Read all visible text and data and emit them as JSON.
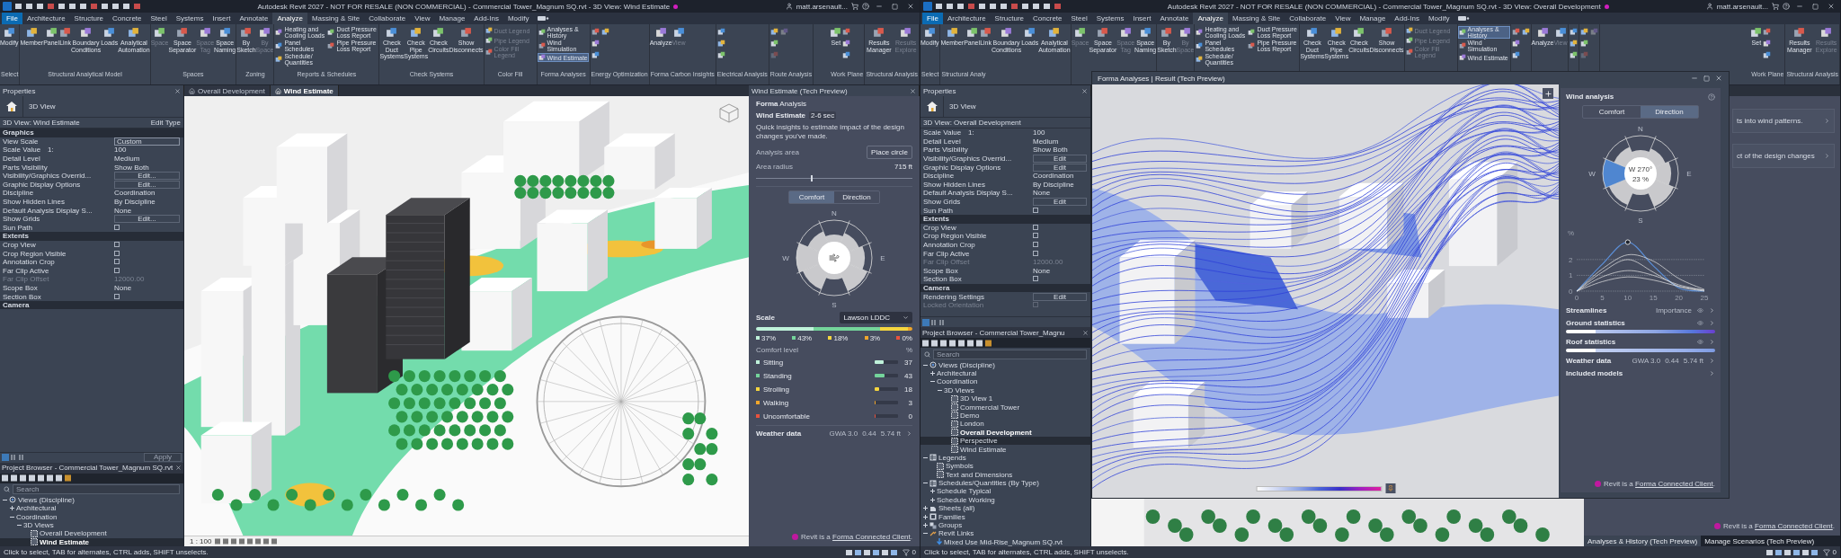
{
  "windows": [
    {
      "title": "Autodesk Revit 2027 - NOT FOR RESALE (NON COMMERCIAL) - Commercial Tower_Magnum SQ.rvt - 3D View: Wind Estimate",
      "user": "matt.arsenault...",
      "menu_tabs": [
        {
          "label": "File",
          "kind": "file",
          "selected": false
        },
        {
          "label": "Architecture",
          "kind": "tab",
          "selected": false
        },
        {
          "label": "Structure",
          "kind": "tab",
          "selected": false
        },
        {
          "label": "Concrete",
          "kind": "tab",
          "selected": false
        },
        {
          "label": "Steel",
          "kind": "tab",
          "selected": false
        },
        {
          "label": "Systems",
          "kind": "tab",
          "selected": false
        },
        {
          "label": "Insert",
          "kind": "tab",
          "selected": false
        },
        {
          "label": "Annotate",
          "kind": "tab",
          "selected": false
        },
        {
          "label": "Analyze",
          "kind": "tab",
          "selected": true
        },
        {
          "label": "Massing & Site",
          "kind": "tab",
          "selected": false
        },
        {
          "label": "Collaborate",
          "kind": "tab",
          "selected": false
        },
        {
          "label": "View",
          "kind": "tab",
          "selected": false
        },
        {
          "label": "Manage",
          "kind": "tab",
          "selected": false
        },
        {
          "label": "Add-Ins",
          "kind": "tab",
          "selected": false
        },
        {
          "label": "Modify",
          "kind": "tab",
          "selected": false
        }
      ],
      "ribbon": [
        {
          "label": "Select",
          "items": [
            {
              "kind": "large",
              "label": "Modify",
              "disabled": false
            }
          ]
        },
        {
          "label": "Structural Analytical Model",
          "items": [
            {
              "kind": "large",
              "label": "Member",
              "disabled": false
            },
            {
              "kind": "large",
              "label": "Panel",
              "disabled": false
            },
            {
              "kind": "large",
              "label": "Link",
              "disabled": false
            },
            {
              "kind": "large",
              "label": "Boundary Conditions",
              "disabled": false
            },
            {
              "kind": "large",
              "label": "Loads",
              "disabled": false
            },
            {
              "kind": "large",
              "label": "Analytical Automation",
              "disabled": false
            }
          ]
        },
        {
          "label": "Spaces",
          "items": [
            {
              "kind": "large",
              "label": "Space",
              "disabled": true
            },
            {
              "kind": "large",
              "label": "Space Separator",
              "disabled": false
            },
            {
              "kind": "large",
              "label": "Space Tag",
              "disabled": true
            },
            {
              "kind": "large",
              "label": "Space Naming",
              "disabled": false
            }
          ]
        },
        {
          "label": "Zoning",
          "items": [
            {
              "kind": "large",
              "label": "By Sketch",
              "disabled": false
            },
            {
              "kind": "large",
              "label": "By Space",
              "disabled": true
            }
          ]
        },
        {
          "label": "Reports & Schedules",
          "items": [
            {
              "kind": "small",
              "label": "Heating and Cooling Loads",
              "disabled": false
            },
            {
              "kind": "small",
              "label": "Panel Schedules",
              "disabled": false
            },
            {
              "kind": "small",
              "label": "Schedule/ Quantities",
              "disabled": false
            },
            {
              "kind": "small",
              "label": "Duct Pressure Loss Report",
              "disabled": false
            },
            {
              "kind": "small",
              "label": "Pipe Pressure Loss Report",
              "disabled": false
            }
          ]
        },
        {
          "label": "Check Systems",
          "items": [
            {
              "kind": "large",
              "label": "Check Duct Systems",
              "disabled": false
            },
            {
              "kind": "large",
              "label": "Check Pipe Systems",
              "disabled": false
            },
            {
              "kind": "large",
              "label": "Check Circuits",
              "disabled": false
            },
            {
              "kind": "large",
              "label": "Show Disconnects",
              "disabled": false
            }
          ]
        },
        {
          "label": "Color Fill",
          "items": [
            {
              "kind": "small",
              "label": "Duct Legend",
              "disabled": true
            },
            {
              "kind": "small",
              "label": "Pipe Legend",
              "disabled": true
            },
            {
              "kind": "small",
              "label": "Color Fill Legend",
              "disabled": true
            }
          ]
        },
        {
          "label": "Forma Analyses",
          "items": [
            {
              "kind": "small",
              "label": "Analyses & History",
              "disabled": false,
              "selected": false
            },
            {
              "kind": "small",
              "label": "Wind Simulation",
              "disabled": false,
              "selected": false
            },
            {
              "kind": "small",
              "label": "Wind Estimate",
              "disabled": false,
              "selected": true
            }
          ]
        },
        {
          "label": "Energy Optimization",
          "items": [
            {
              "kind": "icon",
              "disabled": false
            },
            {
              "kind": "icon",
              "disabled": false
            },
            {
              "kind": "icon",
              "disabled": false
            },
            {
              "kind": "icon",
              "disabled": false
            }
          ]
        },
        {
          "label": "Forma Carbon Insights",
          "items": [
            {
              "kind": "large",
              "label": "Analyze",
              "disabled": false
            },
            {
              "kind": "large",
              "label": "View",
              "disabled": true
            }
          ]
        },
        {
          "label": "Electrical Analysis",
          "items": [
            {
              "kind": "icon",
              "disabled": false
            },
            {
              "kind": "icon",
              "disabled": false
            },
            {
              "kind": "icon",
              "disabled": false
            }
          ]
        },
        {
          "label": "Route Analysis",
          "items": [
            {
              "kind": "icon",
              "disabled": false
            },
            {
              "kind": "icon",
              "disabled": false
            },
            {
              "kind": "icon",
              "disabled": true
            },
            {
              "kind": "icon",
              "disabled": true
            }
          ]
        },
        {
          "label": "Work Plane",
          "items": [
            {
              "kind": "large",
              "label": "Set",
              "disabled": false
            },
            {
              "kind": "icon",
              "disabled": false
            },
            {
              "kind": "icon",
              "disabled": false
            },
            {
              "kind": "icon",
              "disabled": false
            }
          ]
        },
        {
          "label": "Structural Analysis",
          "items": [
            {
              "kind": "large",
              "label": "Results Manager",
              "disabled": false
            },
            {
              "kind": "large",
              "label": "Results Explore",
              "disabled": true
            }
          ]
        }
      ],
      "dock_header": "Properties",
      "view_tabs": [
        {
          "label": "Overall Development",
          "selected": false
        },
        {
          "label": "Wind Estimate",
          "selected": true
        }
      ],
      "side_header": "Wind Estimate (Tech Preview)",
      "properties": {
        "type": "3D View",
        "instance": "3D View: Wind Estimate",
        "edit_type": "Edit Type",
        "apply": "Apply",
        "sections": [
          {
            "title": "Graphics",
            "rows": [
              {
                "label": "View Scale",
                "kind": "field",
                "value": "Custom",
                "disabled": false
              },
              {
                "label": "Scale Value",
                "unit": "1:",
                "kind": "text",
                "value": "100",
                "disabled": false
              },
              {
                "label": "Detail Level",
                "kind": "text",
                "value": "Medium",
                "disabled": false
              },
              {
                "label": "Parts Visibility",
                "kind": "text",
                "value": "Show Both",
                "disabled": false
              },
              {
                "label": "Visibility/Graphics Overrid...",
                "kind": "button",
                "value": "Edit...",
                "disabled": false
              },
              {
                "label": "Graphic Display Options",
                "kind": "button",
                "value": "Edit...",
                "disabled": false
              },
              {
                "label": "Discipline",
                "kind": "text",
                "value": "Coordination",
                "disabled": false
              },
              {
                "label": "Show Hidden Lines",
                "kind": "text",
                "value": "By Discipline",
                "disabled": false
              },
              {
                "label": "Default Analysis Display S...",
                "kind": "text",
                "value": "None",
                "disabled": false
              },
              {
                "label": "Show Grids",
                "kind": "button",
                "value": "Edit...",
                "disabled": false
              },
              {
                "label": "Sun Path",
                "kind": "checkbox",
                "checked": false,
                "disabled": false
              }
            ]
          },
          {
            "title": "Extents",
            "rows": [
              {
                "label": "Crop View",
                "kind": "checkbox",
                "checked": false,
                "disabled": false
              },
              {
                "label": "Crop Region Visible",
                "kind": "checkbox",
                "checked": false,
                "disabled": false
              },
              {
                "label": "Annotation Crop",
                "kind": "checkbox",
                "checked": false,
                "disabled": false
              },
              {
                "label": "Far Clip Active",
                "kind": "checkbox",
                "checked": false,
                "disabled": false
              },
              {
                "label": "Far Clip Offset",
                "kind": "text",
                "value": "12000.00",
                "disabled": true
              },
              {
                "label": "Scope Box",
                "kind": "text",
                "value": "None",
                "disabled": false
              },
              {
                "label": "Section Box",
                "kind": "checkbox",
                "checked": false,
                "disabled": false
              }
            ]
          },
          {
            "title": "Camera"
          }
        ]
      },
      "browser": {
        "title": "Project Browser - Commercial Tower_Magnum SQ.rvt",
        "search_placeholder": "Search",
        "tree": [
          {
            "label": "Views (Discipline)",
            "kind": "views",
            "expanded": true,
            "children": [
              {
                "label": "Architectural",
                "expanded": false
              },
              {
                "label": "Coordination",
                "expanded": true,
                "children": [
                  {
                    "label": "3D Views",
                    "expanded": true,
                    "children": [
                      {
                        "label": "Overall Development",
                        "kind": "view",
                        "current": false,
                        "selected": false
                      },
                      {
                        "label": "Wind Estimate",
                        "kind": "view",
                        "current": true,
                        "selected": true
                      }
                    ]
                  }
                ]
              }
            ]
          }
        ]
      },
      "viewport": {
        "kind": "city",
        "scale": "1 : 100"
      },
      "side_panel": {
        "kind": "wind_estimate",
        "brand": "**Forma** Analysis",
        "heading": "Wind Estimate",
        "badge": "2-6 sec",
        "description": "Quick insights to estimate impact of the design changes you've made.",
        "area_label": "Analysis area",
        "area_button": "Place circle",
        "radius_label": "Area radius",
        "radius_value": "715 ft",
        "radius_slider": {
          "level": 0.35
        },
        "tabs": [
          {
            "label": "Comfort",
            "selected": true
          },
          {
            "label": "Direction",
            "selected": false
          }
        ],
        "rose": {
          "kind": "comfort",
          "labels": [
            "N",
            "E",
            "S",
            "W"
          ]
        },
        "scale_label": "Scale",
        "scale_value": "Lawson LDDC",
        "shares": [
          {
            "text": "37%",
            "color": "#bff2da"
          },
          {
            "text": "43%",
            "color": "#74d49b"
          },
          {
            "text": "18%",
            "color": "#f5d53f"
          },
          {
            "text": "3%",
            "color": "#f0a62c"
          },
          {
            "text": "0%",
            "color": "#e8523d"
          }
        ],
        "comfort_header": "Comfort level",
        "percent_header": "%",
        "comfort_rows": [
          {
            "label": "Sitting",
            "value": "37",
            "level": 0.37,
            "color": "#bff2da"
          },
          {
            "label": "Standing",
            "value": "43",
            "level": 0.43,
            "color": "#74d49b"
          },
          {
            "label": "Strolling",
            "value": "18",
            "level": 0.18,
            "color": "#f5d53f"
          },
          {
            "label": "Walking",
            "value": "3",
            "level": 0.03,
            "color": "#f0a62c"
          },
          {
            "label": "Uncomfortable",
            "value": "0",
            "level": 0,
            "color": "#e8523d"
          }
        ],
        "weather": {
          "label": "Weather data",
          "values": [
            "GWA 3.0",
            "0.44",
            "5.74 ft"
          ]
        },
        "footer": {
          "text": "Revit is a ",
          "link": "Forma Connected Client",
          "after": "."
        }
      },
      "status": "Click to select, TAB for alternates, CTRL adds, SHIFT unselects.",
      "filter_count": "0"
    },
    {
      "title": "Autodesk Revit 2027 - NOT FOR RESALE (NON COMMERCIAL) - Commercial Tower_Magnum SQ.rvt - 3D View: Overall Development",
      "user": "matt.arsenault...",
      "menu_tabs": [
        {
          "label": "File",
          "kind": "file",
          "selected": false
        },
        {
          "label": "Architecture",
          "kind": "tab",
          "selected": false
        },
        {
          "label": "Structure",
          "kind": "tab",
          "selected": false
        },
        {
          "label": "Concrete",
          "kind": "tab",
          "selected": false
        },
        {
          "label": "Steel",
          "kind": "tab",
          "selected": false
        },
        {
          "label": "Systems",
          "kind": "tab",
          "selected": false
        },
        {
          "label": "Insert",
          "kind": "tab",
          "selected": false
        },
        {
          "label": "Annotate",
          "kind": "tab",
          "selected": false
        },
        {
          "label": "Analyze",
          "kind": "tab",
          "selected": true
        },
        {
          "label": "Massing & Site",
          "kind": "tab",
          "selected": false
        },
        {
          "label": "Collaborate",
          "kind": "tab",
          "selected": false
        },
        {
          "label": "View",
          "kind": "tab",
          "selected": false
        },
        {
          "label": "Manage",
          "kind": "tab",
          "selected": false
        },
        {
          "label": "Add-Ins",
          "kind": "tab",
          "selected": false
        },
        {
          "label": "Modify",
          "kind": "tab",
          "selected": false
        }
      ],
      "ribbon": [
        {
          "label": "Select",
          "items": [
            {
              "kind": "large",
              "label": "Modify",
              "disabled": false
            }
          ]
        },
        {
          "label": "Structural Analy",
          "items": [
            {
              "kind": "large",
              "label": "Member",
              "disabled": false
            },
            {
              "kind": "large",
              "label": "Panel",
              "disabled": false
            },
            {
              "kind": "large",
              "label": "Link",
              "disabled": false
            },
            {
              "kind": "large",
              "label": "Boundary Conditions",
              "disabled": false
            },
            {
              "kind": "large",
              "label": "Loads",
              "disabled": false
            },
            {
              "kind": "large",
              "label": "Analytical Automation",
              "disabled": false
            }
          ]
        },
        {
          "items": [
            {
              "kind": "large",
              "label": "Space",
              "disabled": true
            },
            {
              "kind": "large",
              "label": "Space Separator",
              "disabled": false
            },
            {
              "kind": "large",
              "label": "Space Tag",
              "disabled": true
            },
            {
              "kind": "large",
              "label": "Space Naming",
              "disabled": false
            }
          ]
        },
        {
          "items": [
            {
              "kind": "large",
              "label": "By Sketch",
              "disabled": false
            },
            {
              "kind": "large",
              "label": "By Space",
              "disabled": true
            }
          ]
        },
        {
          "items": [
            {
              "kind": "small",
              "label": "Heating and Cooling Loads",
              "disabled": false
            },
            {
              "kind": "small",
              "label": "Panel Schedules",
              "disabled": false
            },
            {
              "kind": "small",
              "label": "Schedule/ Quantities",
              "disabled": false
            },
            {
              "kind": "small",
              "label": "Duct Pressure Loss Report",
              "disabled": false
            },
            {
              "kind": "small",
              "label": "Pipe Pressure Loss Report",
              "disabled": false
            }
          ]
        },
        {
          "items": [
            {
              "kind": "large",
              "label": "Check Duct Systems",
              "disabled": false
            },
            {
              "kind": "large",
              "label": "Check Pipe Systems",
              "disabled": false
            },
            {
              "kind": "large",
              "label": "Check Circuits",
              "disabled": false
            },
            {
              "kind": "large",
              "label": "Show Disconnects",
              "disabled": false
            }
          ]
        },
        {
          "items": [
            {
              "kind": "small",
              "label": "Duct Legend",
              "disabled": true
            },
            {
              "kind": "small",
              "label": "Pipe Legend",
              "disabled": true
            },
            {
              "kind": "small",
              "label": "Color Fill Legend",
              "disabled": true
            }
          ]
        },
        {
          "items": [
            {
              "kind": "small",
              "label": "Analyses & History",
              "disabled": false,
              "selected": true
            },
            {
              "kind": "small",
              "label": "Wind Simulation",
              "disabled": false,
              "selected": false
            },
            {
              "kind": "small",
              "label": "Wind Estimate",
              "disabled": false,
              "selected": false
            }
          ]
        },
        {
          "items": [
            {
              "kind": "icon",
              "disabled": false
            },
            {
              "kind": "icon",
              "disabled": false
            },
            {
              "kind": "icon",
              "disabled": false
            },
            {
              "kind": "icon",
              "disabled": false
            }
          ]
        },
        {
          "items": [
            {
              "kind": "large",
              "label": "Analyze",
              "disabled": false
            },
            {
              "kind": "large",
              "label": "View",
              "disabled": true
            }
          ]
        },
        {
          "items": [
            {
              "kind": "icon",
              "disabled": false
            },
            {
              "kind": "icon",
              "disabled": false
            },
            {
              "kind": "icon",
              "disabled": false
            }
          ]
        },
        {
          "items": [
            {
              "kind": "icon",
              "disabled": false
            },
            {
              "kind": "icon",
              "disabled": false
            },
            {
              "kind": "icon",
              "disabled": true
            },
            {
              "kind": "icon",
              "disabled": true
            }
          ]
        },
        {
          "label": "Work Plane",
          "items": [
            {
              "kind": "large",
              "label": "Set",
              "disabled": false
            },
            {
              "kind": "icon",
              "disabled": false
            },
            {
              "kind": "icon",
              "disabled": false
            },
            {
              "kind": "icon",
              "disabled": false
            }
          ]
        },
        {
          "label": "Structural Analysis",
          "items": [
            {
              "kind": "large",
              "label": "Results Manager",
              "disabled": false
            },
            {
              "kind": "large",
              "label": "Results Explore",
              "disabled": true
            }
          ]
        }
      ],
      "dock_header": "Properties",
      "properties": {
        "type": "3D View",
        "instance": "3D View: Overall Development",
        "sections": [
          {
            "rows": [
              {
                "label": "Scale Value",
                "unit": "1:",
                "kind": "text",
                "value": "100",
                "disabled": false
              },
              {
                "label": "Detail Level",
                "kind": "text",
                "value": "Medium",
                "disabled": false
              },
              {
                "label": "Parts Visibility",
                "kind": "text",
                "value": "Show Both",
                "disabled": false
              },
              {
                "label": "Visibility/Graphics Overrid...",
                "kind": "button",
                "value": "Edit",
                "disabled": false
              },
              {
                "label": "Graphic Display Options",
                "kind": "button",
                "value": "Edit",
                "disabled": false
              },
              {
                "label": "Discipline",
                "kind": "text",
                "value": "Coordination",
                "disabled": false
              },
              {
                "label": "Show Hidden Lines",
                "kind": "text",
                "value": "By Discipline",
                "disabled": false
              },
              {
                "label": "Default Analysis Display S...",
                "kind": "text",
                "value": "None",
                "disabled": false
              },
              {
                "label": "Show Grids",
                "kind": "button",
                "value": "Edit",
                "disabled": false
              },
              {
                "label": "Sun Path",
                "kind": "checkbox",
                "checked": false,
                "disabled": false
              }
            ]
          },
          {
            "title": "Extents",
            "rows": [
              {
                "label": "Crop View",
                "kind": "checkbox",
                "checked": false,
                "disabled": false
              },
              {
                "label": "Crop Region Visible",
                "kind": "checkbox",
                "checked": false,
                "disabled": false
              },
              {
                "label": "Annotation Crop",
                "kind": "checkbox",
                "checked": false,
                "disabled": false
              },
              {
                "label": "Far Clip Active",
                "kind": "checkbox",
                "checked": false,
                "disabled": false
              },
              {
                "label": "Far Clip Offset",
                "kind": "text",
                "value": "12000.00",
                "disabled": true
              },
              {
                "label": "Scope Box",
                "kind": "text",
                "value": "None",
                "disabled": false
              },
              {
                "label": "Section Box",
                "kind": "checkbox",
                "checked": false,
                "disabled": false
              }
            ]
          },
          {
            "title": "Camera",
            "rows": [
              {
                "label": "Rendering Settings",
                "kind": "button",
                "value": "Edit",
                "disabled": false
              },
              {
                "label": "Locked Orientation",
                "kind": "checkbox",
                "checked": false,
                "disabled": true
              }
            ]
          }
        ]
      },
      "browser": {
        "title": "Project Browser - Commercial Tower_Magnu",
        "search_placeholder": "Search",
        "tree": [
          {
            "label": "Views (Discipline)",
            "kind": "views",
            "expanded": true,
            "children": [
              {
                "label": "Architectural",
                "expanded": false
              },
              {
                "label": "Coordination",
                "expanded": true,
                "children": [
                  {
                    "label": "3D Views",
                    "expanded": true,
                    "children": [
                      {
                        "label": "3D View 1",
                        "kind": "view",
                        "current": false,
                        "selected": false
                      },
                      {
                        "label": "Commercial Tower",
                        "kind": "view",
                        "current": false,
                        "selected": false
                      },
                      {
                        "label": "Demo",
                        "kind": "view",
                        "current": false,
                        "selected": false
                      },
                      {
                        "label": "London",
                        "kind": "view",
                        "current": false,
                        "selected": false
                      },
                      {
                        "label": "Overall Development",
                        "kind": "view",
                        "current": true,
                        "selected": false
                      },
                      {
                        "label": "Perspective",
                        "kind": "view",
                        "current": false,
                        "selected": true
                      },
                      {
                        "label": "Wind Estimate",
                        "kind": "view",
                        "current": false,
                        "selected": false
                      }
                    ]
                  }
                ]
              }
            ]
          },
          {
            "label": "Legends",
            "kind": "legend",
            "expanded": true,
            "children": [
              {
                "label": "Symbols",
                "kind": "view",
                "current": false,
                "selected": false
              },
              {
                "label": "Text and Dimensions",
                "kind": "view",
                "current": false,
                "selected": false
              }
            ]
          },
          {
            "label": "Schedules/Quantities (By Type)",
            "kind": "schedule",
            "expanded": true,
            "children": [
              {
                "label": "Schedule Typical",
                "expanded": false
              },
              {
                "label": "Schedule Working",
                "expanded": false
              }
            ]
          },
          {
            "label": "Sheets (all)",
            "kind": "sheet",
            "expanded": false
          },
          {
            "label": "Families",
            "kind": "family",
            "expanded": false
          },
          {
            "label": "Groups",
            "kind": "group",
            "expanded": false
          },
          {
            "label": "Revit Links",
            "kind": "link",
            "expanded": true,
            "children": [
              {
                "label": "Mixed Use Mid-Rise_Magnum SQ.rvt",
                "kind": "model"
              }
            ]
          }
        ]
      },
      "viewport": {
        "kind": "trees"
      },
      "side_panel": {
        "kind": "docked",
        "cards": [
          "ts into wind patterns.",
          "ct of the design changes"
        ],
        "footer": {
          "text": "Revit is a ",
          "link": "Forma Connected Client",
          "after": "."
        },
        "tabs": [
          {
            "label": "Analyses & History (Tech Preview)",
            "selected": true
          },
          {
            "label": "Manage Scenarios (Tech Preview)",
            "selected": false
          }
        ]
      },
      "floating": {
        "title": "Forma Analyses | Result (Tech Preview)",
        "panel": {
          "title": "Wind analysis",
          "tabs": [
            {
              "label": "Comfort",
              "selected": false
            },
            {
              "label": "Direction",
              "selected": true
            }
          ],
          "rose": {
            "kind": "direction",
            "labels": [
              "N",
              "E",
              "S",
              "W"
            ],
            "center_direction": "W 270°",
            "center_value": "23 %"
          },
          "chart": {
            "ylabel": "%",
            "yticks": [
              "2",
              "1",
              "0"
            ],
            "xticks": [
              "0",
              "5",
              "10",
              "15",
              "20",
              "25"
            ]
          },
          "rows": [
            {
              "kind": "streamlines",
              "label": "Streamlines",
              "value": "Importance"
            },
            {
              "kind": "stat",
              "label": "Ground statistics"
            },
            {
              "kind": "stat",
              "label": "Roof statistics"
            },
            {
              "kind": "weather",
              "label": "Weather data",
              "values": [
                "GWA 3.0",
                "0.44",
                "5.74 ft"
              ]
            },
            {
              "kind": "link",
              "label": "Included models"
            }
          ],
          "footer": {
            "text": "Revit is a ",
            "link": "Forma Connected Client",
            "after": "."
          }
        }
      },
      "status": "Click to select, TAB for alternates, CTRL adds, SHIFT unselects.",
      "filter_count": "0"
    }
  ]
}
